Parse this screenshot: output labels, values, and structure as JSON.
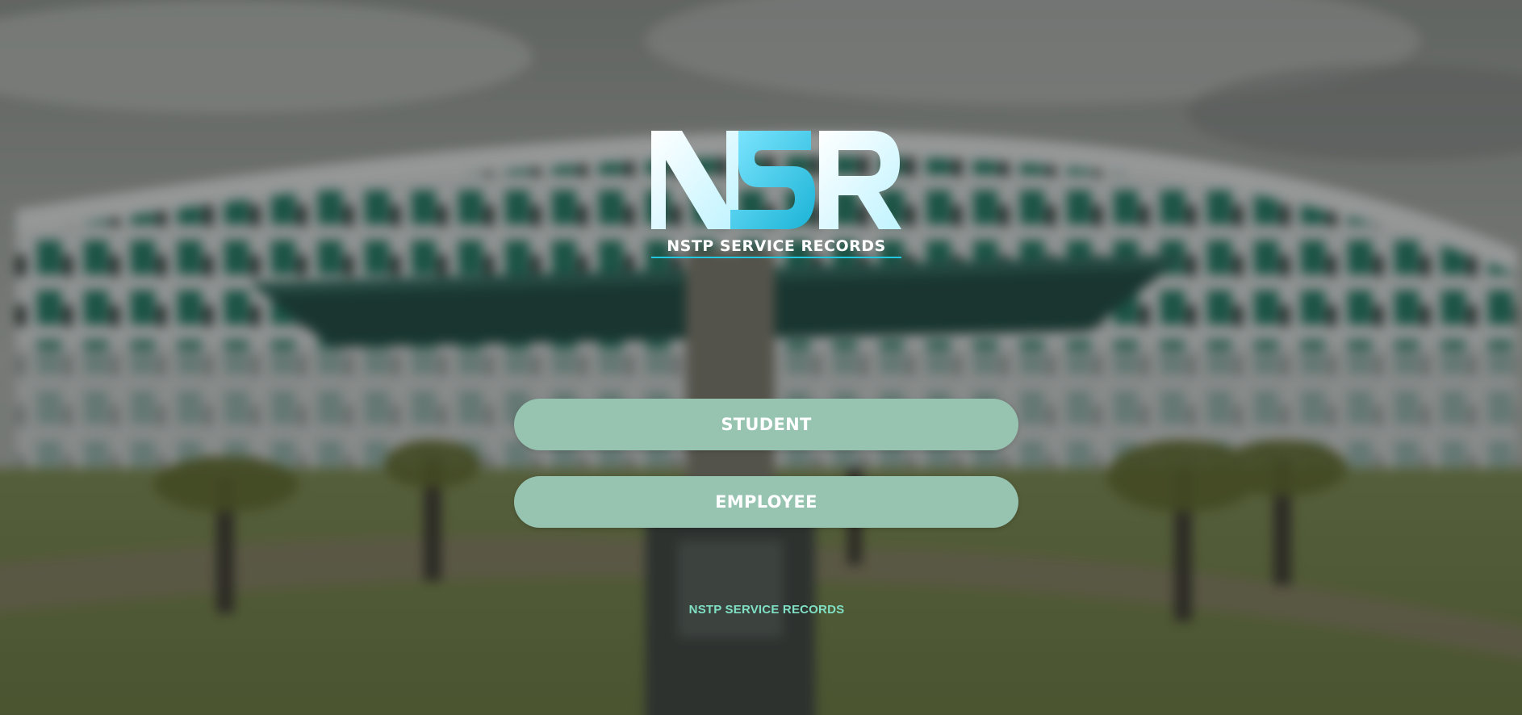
{
  "logo": {
    "lettering": "NSR",
    "tagline": "NSTP SERVICE RECORDS"
  },
  "buttons": {
    "student_label": "STUDENT",
    "employee_label": "EMPLOYEE"
  },
  "footer": {
    "text": "NSTP SERVICE RECORDS"
  },
  "colors": {
    "button_bg": "#97c4b1",
    "button_text": "#ffffff",
    "footer_text": "#7fe0c4",
    "logo_light": "#e6fbff",
    "logo_accent": "#22c7e0"
  }
}
